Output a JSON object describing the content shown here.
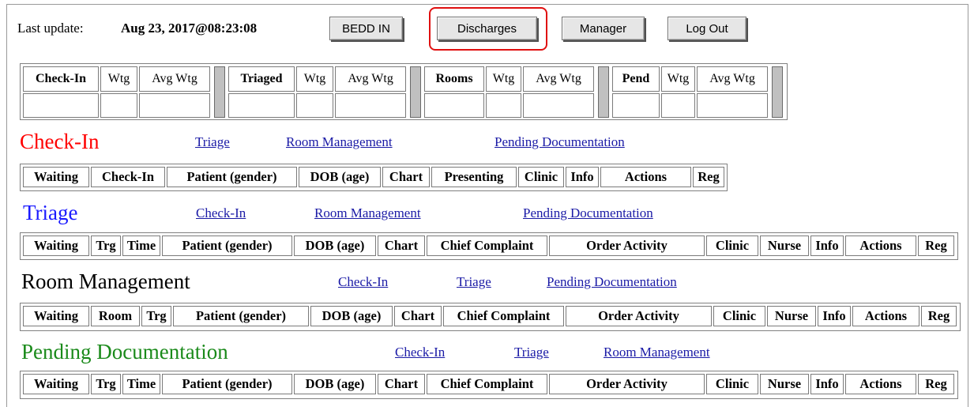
{
  "header": {
    "last_update_label": "Last update:",
    "last_update_value": "Aug 23, 2017@08:23:08",
    "buttons": {
      "bedd_in": "BEDD IN",
      "discharges": "Discharges",
      "manager": "Manager",
      "log_out": "Log Out"
    }
  },
  "stats": {
    "groups": [
      {
        "name": "Check-In",
        "wtg": "Wtg",
        "avg": "Avg Wtg"
      },
      {
        "name": "Triaged",
        "wtg": "Wtg",
        "avg": "Avg Wtg"
      },
      {
        "name": "Rooms",
        "wtg": "Wtg",
        "avg": "Avg Wtg"
      },
      {
        "name": "Pend",
        "wtg": "Wtg",
        "avg": "Avg Wtg"
      }
    ]
  },
  "sections": {
    "checkin": {
      "title": "Check-In",
      "title_color": "#ff0000",
      "links": [
        "Triage",
        "Room Management",
        "Pending Documentation"
      ],
      "columns": [
        "Waiting",
        "Check-In",
        "Patient (gender)",
        "DOB (age)",
        "Chart",
        "Presenting",
        "Clinic",
        "Info",
        "Actions",
        "Reg"
      ]
    },
    "triage": {
      "title": "Triage",
      "title_color": "#1a1aff",
      "links": [
        "Check-In",
        "Room Management",
        "Pending Documentation"
      ],
      "columns": [
        "Waiting",
        "Trg",
        "Time",
        "Patient (gender)",
        "DOB (age)",
        "Chart",
        "Chief Complaint",
        "Order Activity",
        "Clinic",
        "Nurse",
        "Info",
        "Actions",
        "Reg"
      ]
    },
    "room": {
      "title": "Room Management",
      "title_color": "#000000",
      "links": [
        "Check-In",
        "Triage",
        "Pending Documentation"
      ],
      "columns": [
        "Waiting",
        "Room",
        "Trg",
        "Patient (gender)",
        "DOB (age)",
        "Chart",
        "Chief Complaint",
        "Order Activity",
        "Clinic",
        "Nurse",
        "Info",
        "Actions",
        "Reg"
      ]
    },
    "pending": {
      "title": "Pending Documentation",
      "title_color": "#1a8a1a",
      "links": [
        "Check-In",
        "Triage",
        "Room Management"
      ],
      "columns": [
        "Waiting",
        "Trg",
        "Time",
        "Patient (gender)",
        "DOB (age)",
        "Chart",
        "Chief Complaint",
        "Order Activity",
        "Clinic",
        "Nurse",
        "Info",
        "Actions",
        "Reg"
      ]
    }
  }
}
